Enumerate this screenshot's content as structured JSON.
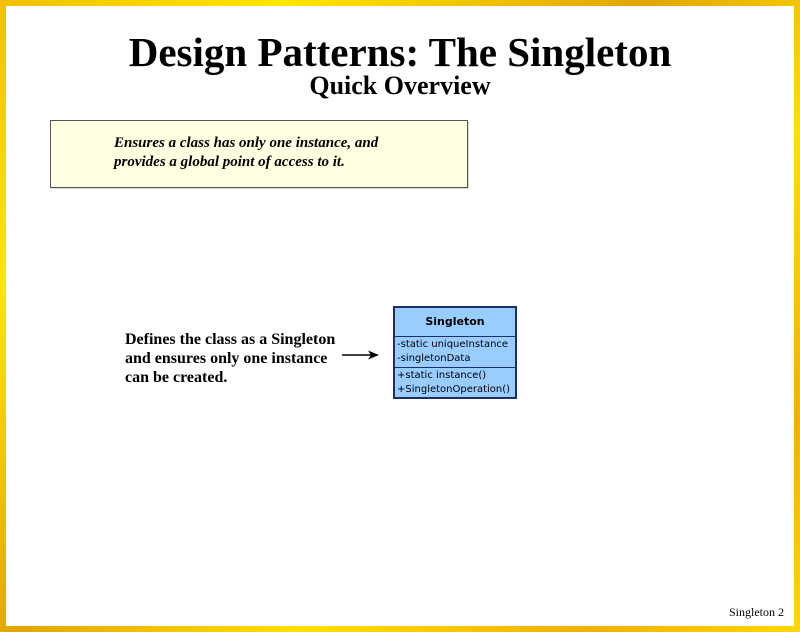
{
  "slide": {
    "title": "Design Patterns: The Singleton",
    "subtitle": "Quick Overview",
    "intent_lines": [
      "Ensures a class has only one instance, and",
      "provides a global point of access to it."
    ],
    "description_lines": [
      "Defines the class as a Singleton",
      "and ensures only one instance",
      "can be created."
    ],
    "footer": "Singleton 2",
    "border_colors": [
      "#f0c000",
      "#ffe600",
      "#e3a500"
    ]
  },
  "uml_class": {
    "name": "Singleton",
    "attributes": [
      "-static uniqueInstance",
      "-singletonData"
    ],
    "operations": [
      "+static instance()",
      "+SingletonOperation()"
    ],
    "fill_color": "#99ccff",
    "stroke_color": "#1c2e6e"
  }
}
